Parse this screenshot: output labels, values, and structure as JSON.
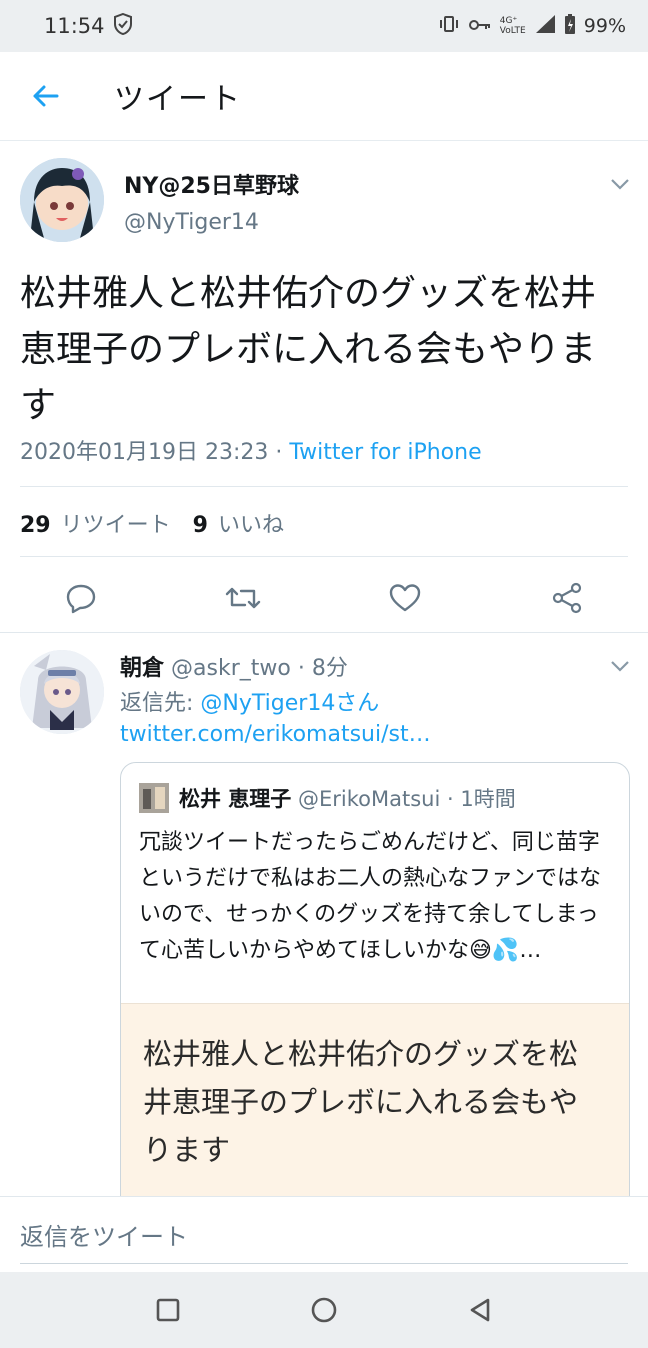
{
  "status": {
    "time": "11:54",
    "network": "4G⁺ VoLTE",
    "battery": "99%"
  },
  "header": {
    "title": "ツイート"
  },
  "tweet": {
    "author_name": "NY@25日草野球",
    "author_handle": "@NyTiger14",
    "text": "松井雅人と松井佑介のグッズを松井恵理子のプレボに入れる会もやります",
    "date": "2020年01月19日 23:23",
    "separator": "·",
    "source": "Twitter for iPhone",
    "retweet_count": "29",
    "retweet_label": "リツイート",
    "like_count": "9",
    "like_label": "いいね"
  },
  "reply": {
    "author_name": "朝倉",
    "author_handle": "@askr_two",
    "time": "8分",
    "reply_to_label": "返信先:",
    "reply_to_user": "@NyTiger14さん",
    "link": "twitter.com/erikomatsui/st…",
    "quote": {
      "author_name": "松井 恵理子",
      "author_handle": "@ErikoMatsui",
      "time": "1時間",
      "text": "冗談ツイートだったらごめんだけど、同じ苗字というだけで私はお二人の熱心なファンではないので、せっかくのグッズを持て余してしまって心苦しいからやめてほしいかな😅💦…",
      "image_text": "松井雅人と松井佑介のグッズを松井恵理子のプレボに入れる会もやります"
    }
  },
  "reply_bar": {
    "placeholder": "返信をツイート"
  },
  "colors": {
    "accent": "#1da1f2",
    "secondary_text": "#657786",
    "divider": "#e1e8ed"
  }
}
